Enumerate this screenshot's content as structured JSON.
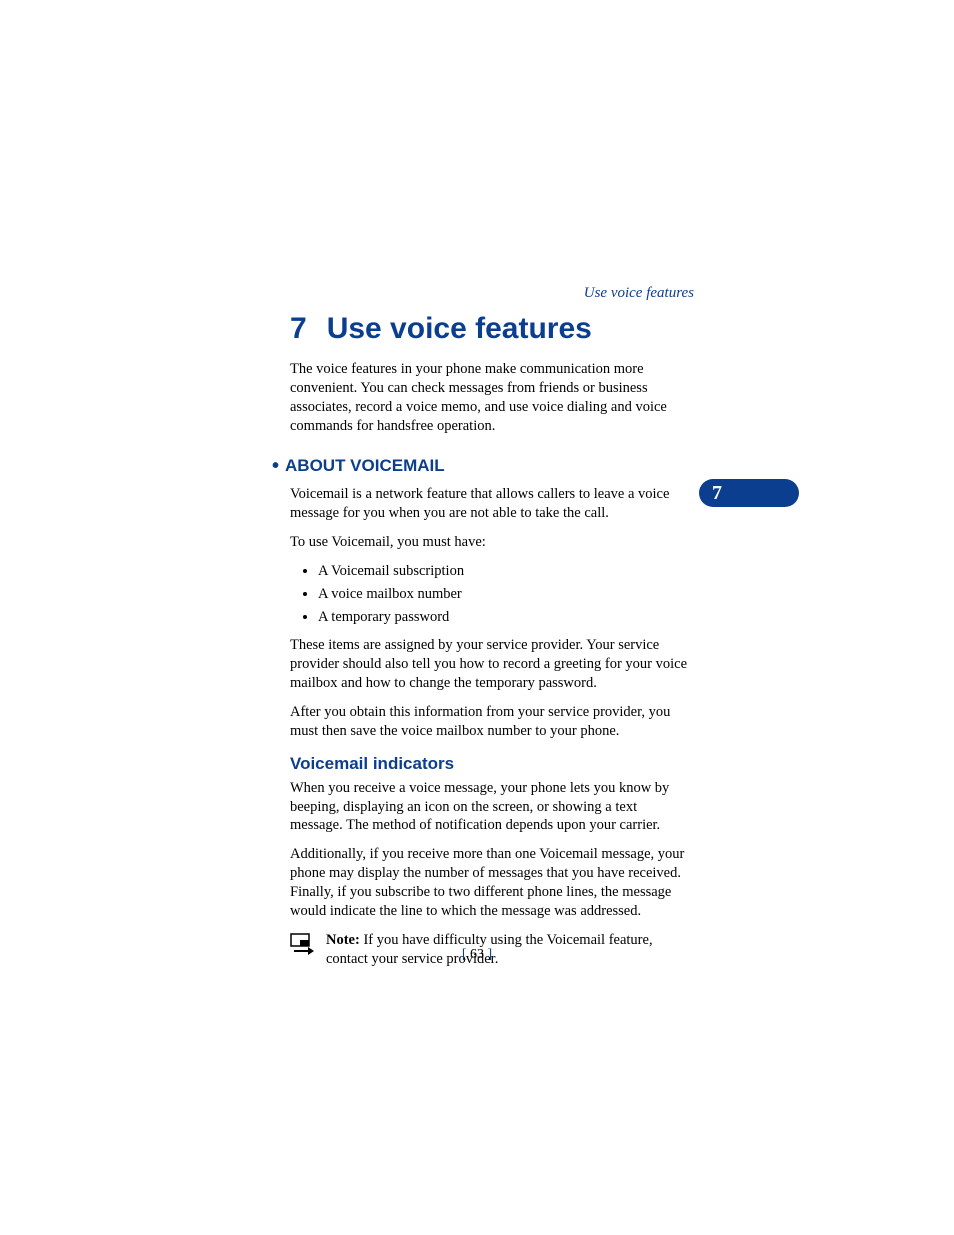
{
  "header": {
    "running_title": "Use voice features"
  },
  "chapter": {
    "number": "7",
    "title": "Use voice features"
  },
  "intro_paragraph": "The voice features in your phone make communication more convenient. You can check messages from friends or business associates, record a voice memo, and use voice dialing and voice commands for handsfree operation.",
  "section1": {
    "heading": "ABOUT VOICEMAIL",
    "para1": "Voicemail is a network feature that allows callers to leave a voice message for you when you are not able to take the call.",
    "para2": "To use Voicemail, you must have:",
    "bullets": {
      "b1": "A Voicemail subscription",
      "b2": "A voice mailbox number",
      "b3": "A temporary password"
    },
    "para3": "These items are assigned by your service provider. Your service provider should also tell you how to record a greeting for your voice mailbox and how to change the temporary password.",
    "para4": "After you obtain this information from your service provider, you must then save the voice mailbox number to your phone."
  },
  "section2": {
    "heading": "Voicemail indicators",
    "para1": "When you receive a voice message, your phone lets you know by beeping, displaying an icon on the screen, or showing a text message. The method of notification depends upon your carrier.",
    "para2": "Additionally, if you receive more than one Voicemail message, your phone may display the number of messages that you have received. Finally, if you subscribe to two different phone lines, the message would indicate the line to which the message was addressed."
  },
  "note": {
    "label": "Note:",
    "text": " If you have difficulty using the Voicemail feature, contact your service provider."
  },
  "side_tab": {
    "number": "7"
  },
  "footer": {
    "page_number": "63"
  }
}
